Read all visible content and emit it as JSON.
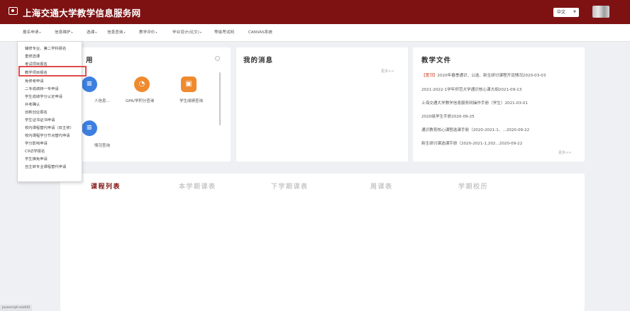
{
  "header": {
    "title": "上海交通大学教学信息服务网",
    "language": "中文",
    "brand_color": "#7e1213"
  },
  "nav": {
    "items": [
      "报名申请",
      "信息维护",
      "选课",
      "信息查询",
      "教学评价",
      "毕业设计(论文)",
      "等级考试网",
      "CANVAS系统"
    ]
  },
  "dropdown": {
    "items": [
      "辅修专业、第二学科报名",
      "重修选课",
      "考试项目报名",
      "教学项目报名",
      "免修考申请",
      "二专成绩转一专申请",
      "学生成绩学分认定申请",
      "补考确认",
      "创新创业报名",
      "学生证书证书申请",
      "校内课程替代申请（双主修）",
      "校内课程学分节点替代申请",
      "学分影响申请",
      "C9访学报名",
      "学生推免申请",
      "自主转专业课程替代申请"
    ],
    "highlighted_index": 3,
    "highlight_color": "#e04b4b"
  },
  "apps_card": {
    "title": "用",
    "items": [
      {
        "label": "人信息...",
        "icon": "user-info-icon",
        "color": "#3d7fe0"
      },
      {
        "label": "GPA/学积分查询",
        "icon": "gpa-icon",
        "color": "#ef8a2e"
      },
      {
        "label": "学生成绩查询",
        "icon": "grade-icon",
        "color": "#ef8a2e"
      },
      {
        "label": "情况查询",
        "icon": "status-icon",
        "color": "#3d7fe0"
      }
    ]
  },
  "messages_card": {
    "title": "我的消息",
    "more": "更多>>"
  },
  "docs_card": {
    "title": "教学文件",
    "items": [
      {
        "tag": "【置顶】",
        "text": "2020年春季通识、公选、新生研讨课程开设情况2020-03-03"
      },
      {
        "tag": "",
        "text": "2021-2022-1学年师范大学通识核心课大纲2021-09-13"
      },
      {
        "tag": "",
        "text": "上海交通大学教学信息服务网操作手册（学生）2021-03-01"
      },
      {
        "tag": "",
        "text": "2020级学生手册2020-09-25"
      },
      {
        "tag": "",
        "text": "通识教育核心课程选课手册（2020-2021-1、...2020-09-22"
      },
      {
        "tag": "",
        "text": "新生研讨课选课手册（2020-2021-1,202...2020-09-22"
      }
    ],
    "more": "更多>>",
    "tag_color": "#d24b33"
  },
  "course_card": {
    "tabs": [
      "课程列表",
      "本学期课表",
      "下学期课表",
      "周课表",
      "学期校历"
    ],
    "active_tab": 0
  },
  "status_hint": "javascript:void(0)"
}
